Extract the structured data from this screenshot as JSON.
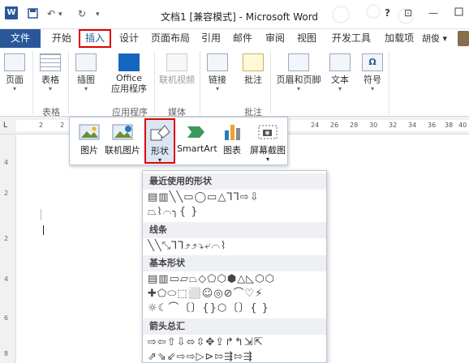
{
  "titlebar": {
    "app_icon": "W",
    "save_icon": "save-icon",
    "undo": "↶",
    "redo": "↻",
    "qa_more": "▾",
    "title": "文档1 [兼容模式] - Microsoft Word",
    "help": "?",
    "minimize": "—",
    "restore": "⊡",
    "close": "✕"
  },
  "tabs": {
    "file": "文件",
    "items": [
      "开始",
      "插入",
      "设计",
      "页面布局",
      "引用",
      "邮件",
      "审阅",
      "视图",
      "开发工具",
      "加载项"
    ],
    "active": "插入",
    "user": "胡俊 ▾"
  },
  "ribbon": {
    "buttons": [
      {
        "label": "页面",
        "caret": "▾"
      },
      {
        "label": "表格",
        "caret": "▾"
      },
      {
        "label": "插图",
        "caret": "▾"
      },
      {
        "label": "Office\n应用程序",
        "caret": "▾"
      },
      {
        "label": "联机视频",
        "caret": ""
      },
      {
        "label": "链接",
        "caret": "▾"
      },
      {
        "label": "批注",
        "caret": ""
      },
      {
        "label": "页眉和页脚",
        "caret": "▾"
      },
      {
        "label": "文本",
        "caret": "▾"
      },
      {
        "label": "符号",
        "caret": "▾"
      }
    ],
    "groups": [
      "表格",
      "应用程序",
      "媒体",
      "批注"
    ]
  },
  "ruler": {
    "tab_selector": "L",
    "numbers": [
      "2",
      "2",
      "24",
      "26",
      "28",
      "30",
      "32",
      "34",
      "36",
      "38",
      "40"
    ]
  },
  "vruler": {
    "numbers": [
      "4",
      "2",
      "2",
      "4",
      "6",
      "8"
    ]
  },
  "illustrations": {
    "items": [
      {
        "label": "图片",
        "caret": ""
      },
      {
        "label": "联机图片",
        "caret": ""
      },
      {
        "label": "形状",
        "caret": "▾"
      },
      {
        "label": "SmartArt",
        "caret": ""
      },
      {
        "label": "图表",
        "caret": ""
      },
      {
        "label": "屏幕截图",
        "caret": "▾"
      }
    ]
  },
  "shapes": {
    "recent_header": "最近使用的形状",
    "recent_row1": "▤▥╲╲▭◯▭△⅂⅂⇨⇩",
    "recent_row2": "⏢⌇⌒╮{ }",
    "lines_header": "线条",
    "lines_row": "╲╲⤡⅂⅂⤴⤴⤵⤶⌒⌇",
    "basic_header": "基本形状",
    "basic_row1": "▤▥▭▱⏢◇⬠⬡⬢△◺⬡⬡",
    "basic_row2": "✚⬠⬭⬚⬜☺◎⊘⌒♡⚡",
    "basic_row3": "☼☾⌒〔〕{}⬡〔〕{ }",
    "arrows_header": "箭头总汇",
    "arrows_row1": "⇨⇦⇧⇩⬄⇳✥⇪↱↰⇲⇱",
    "arrows_row2": "⇗⇘⇙⇨⇨▷⊳⇰⇶⇰⇶"
  }
}
